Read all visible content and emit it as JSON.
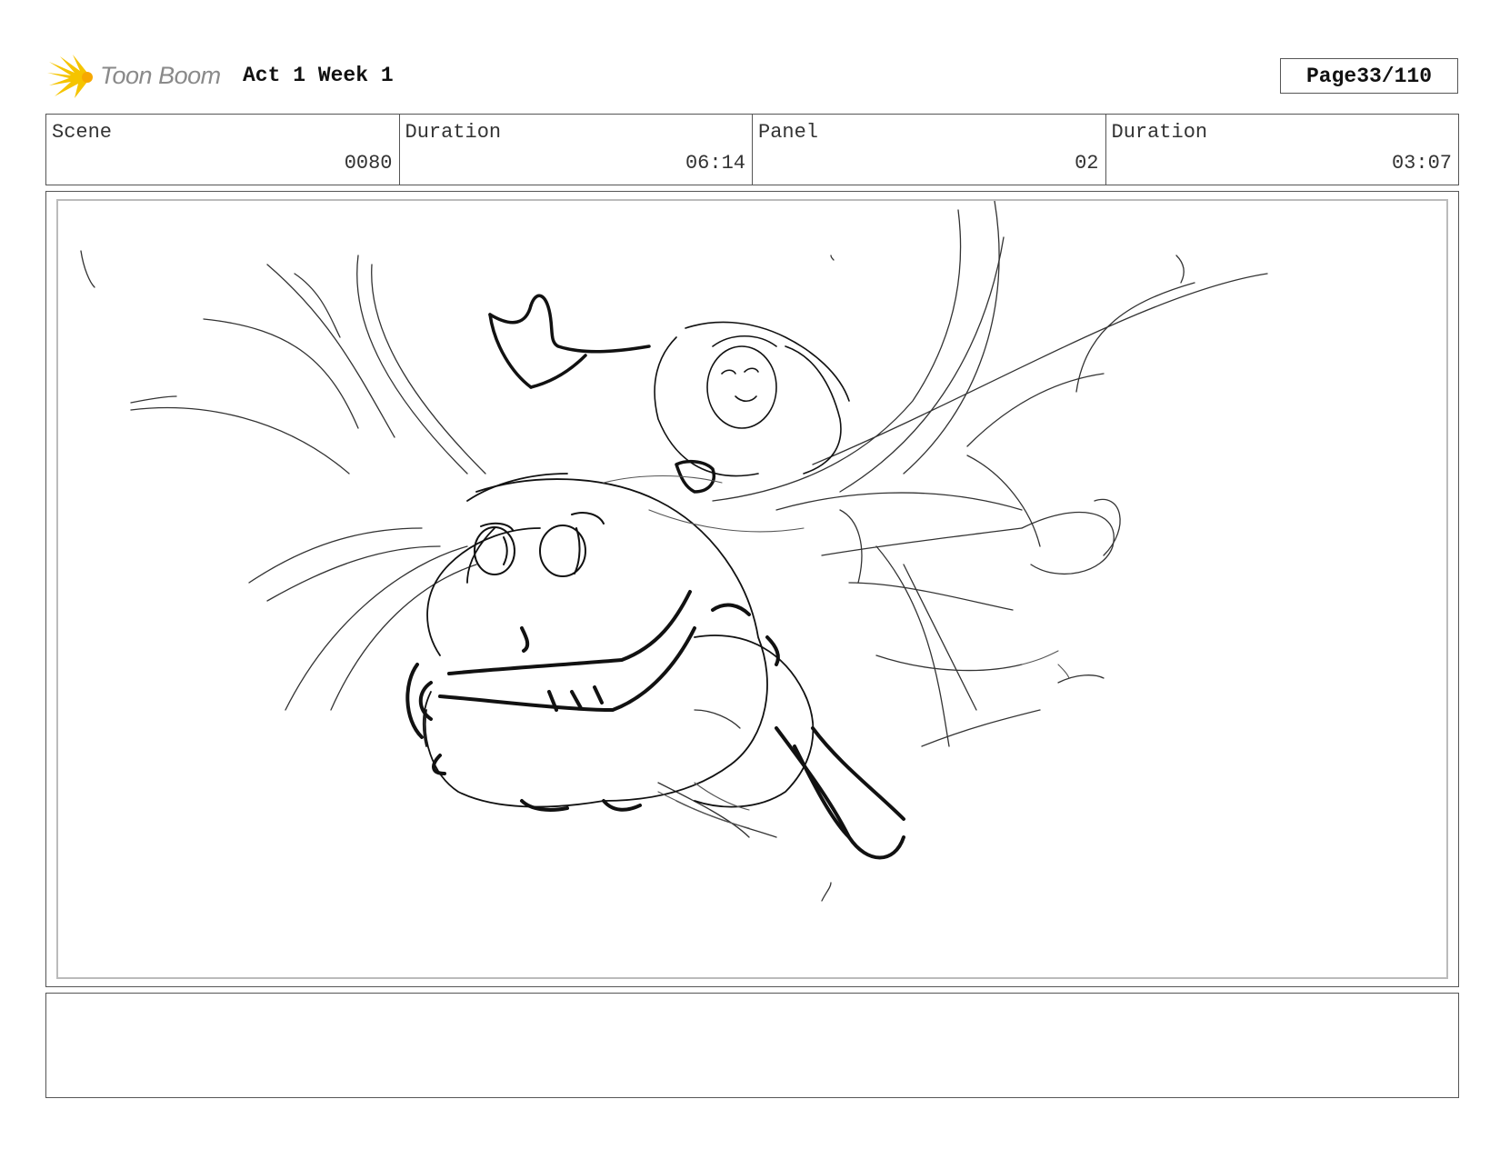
{
  "header": {
    "logo_text": "Toon Boom",
    "project_title": "Act 1 Week 1",
    "page_label": "Page",
    "page_value": "33/110"
  },
  "info": {
    "scene_label": "Scene",
    "scene_value": "0080",
    "scene_duration_label": "Duration",
    "scene_duration_value": "06:14",
    "panel_label": "Panel",
    "panel_value": "02",
    "panel_duration_label": "Duration",
    "panel_duration_value": "03:07"
  },
  "notes": {
    "text": ""
  },
  "colors": {
    "logo_accent": "#f5c400",
    "border": "#555555"
  }
}
